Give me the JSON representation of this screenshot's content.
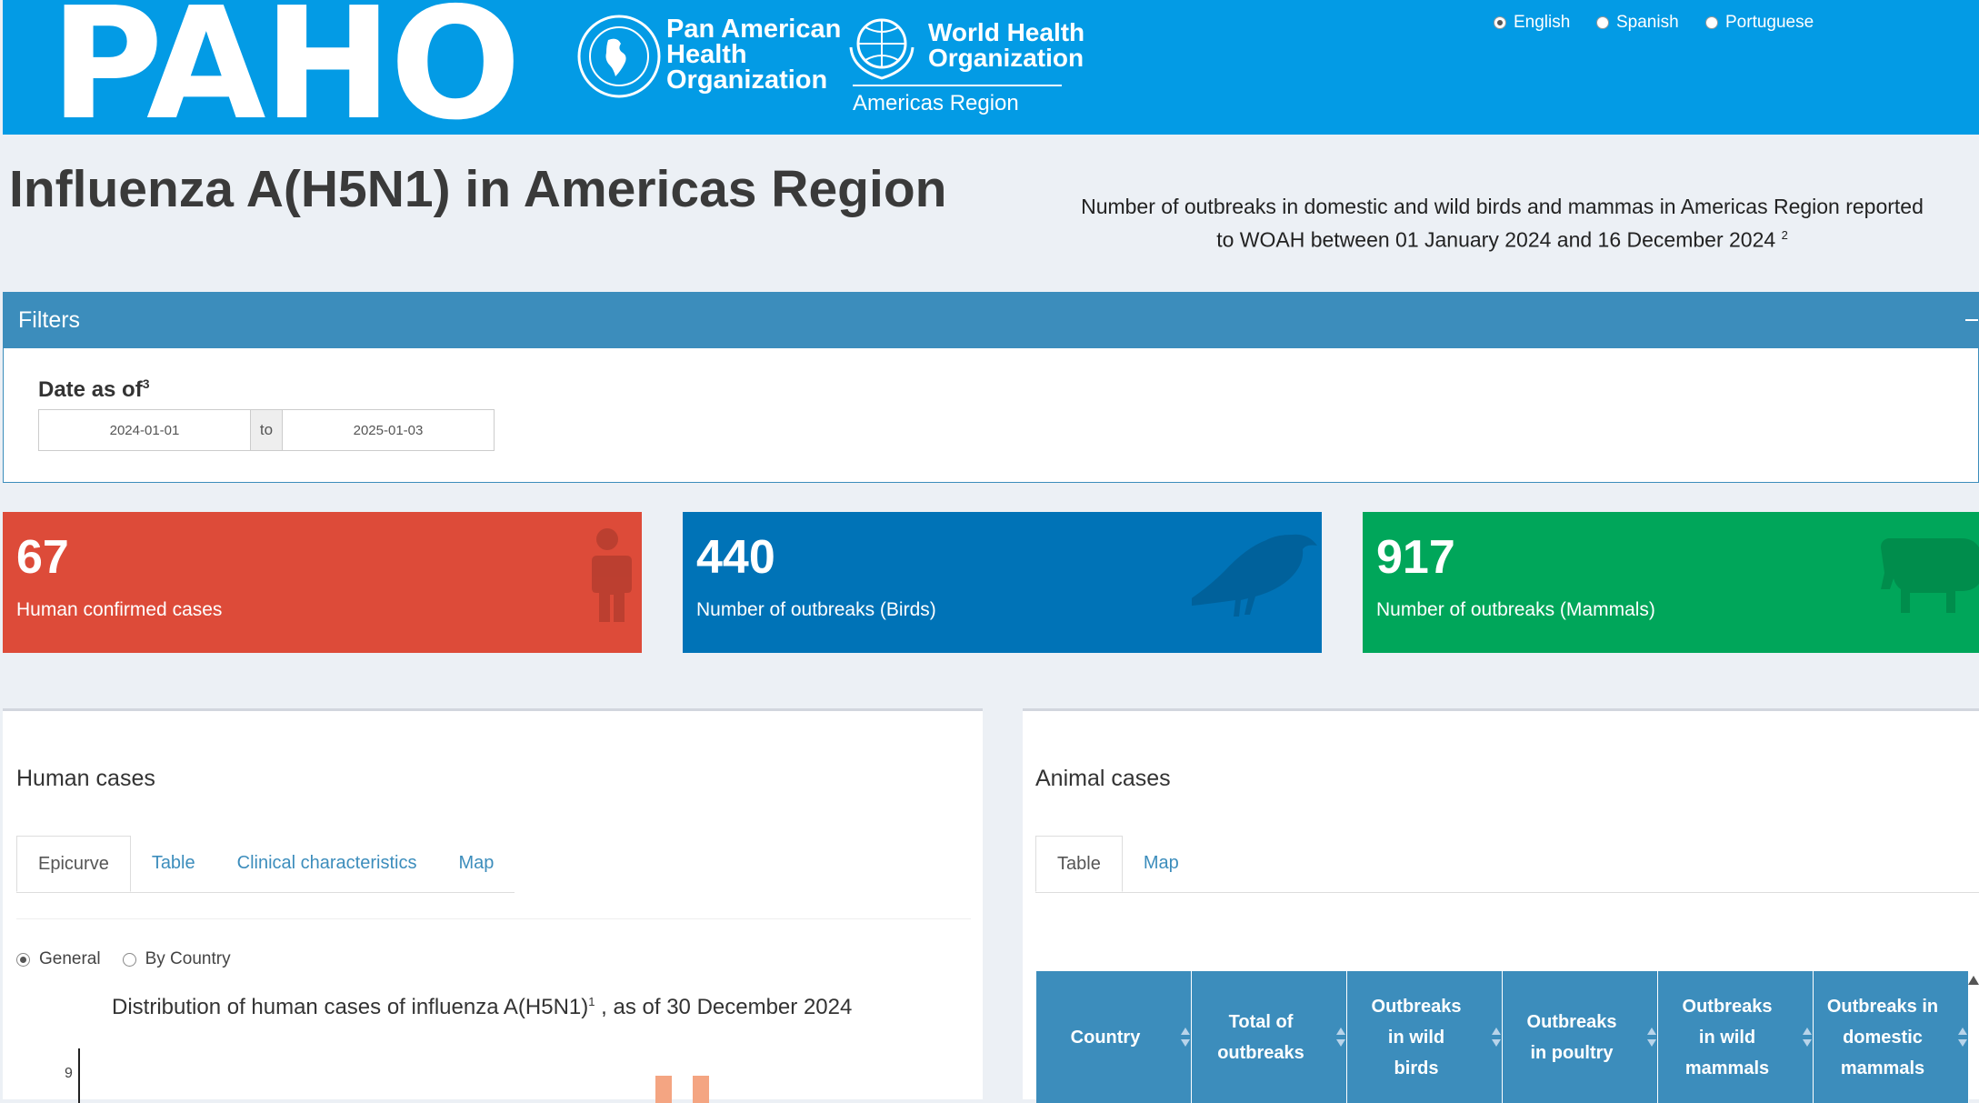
{
  "header": {
    "logo_text": "PAHO",
    "org1_line1": "Pan American",
    "org1_line2": "Health",
    "org1_line3": "Organization",
    "org2_line1": "World Health",
    "org2_line2": "Organization",
    "region": "Americas Region",
    "languages": [
      {
        "label": "English",
        "selected": true
      },
      {
        "label": "Spanish",
        "selected": false
      },
      {
        "label": "Portuguese",
        "selected": false
      }
    ]
  },
  "page": {
    "title": "Influenza A(H5N1) in Americas Region"
  },
  "filters": {
    "title": "Filters",
    "date_label": "Date as of",
    "date_sup": "3",
    "date_start": "2024-01-01",
    "date_sep": "to",
    "date_end": "2025-01-03"
  },
  "kpis": [
    {
      "value": "67",
      "label": "Human confirmed cases",
      "color": "#dd4b39",
      "icon": "person-icon"
    },
    {
      "value": "440",
      "label": "Number of outbreaks (Birds)",
      "color": "#0073b7",
      "icon": "bird-icon"
    },
    {
      "value": "917",
      "label": "Number of outbreaks (Mammals)",
      "color": "#00a65a",
      "icon": "cow-icon"
    }
  ],
  "human": {
    "title": "Human cases",
    "tabs": [
      "Epicurve",
      "Table",
      "Clinical characteristics",
      "Map"
    ],
    "radio_general": "General",
    "radio_by_country": "By Country",
    "chart_title": "Distribution of human cases of influenza A(H5N1)",
    "chart_title_sup": "1",
    "chart_title_suffix": " , as of 30 December 2024",
    "y_tick": "9"
  },
  "animal": {
    "title": "Animal cases",
    "tabs": [
      "Table",
      "Map"
    ],
    "caption_line1": "Number of outbreaks in domestic and wild birds and mammas in Americas Region reported",
    "caption_line2": "to WOAH between 01 January 2024 and 16 December 2024",
    "caption_sup": "2",
    "columns": [
      "Country",
      "Total of outbreaks",
      "Outbreaks in wild birds",
      "Outbreaks in poultry",
      "Outbreaks in wild mammals",
      "Outbreaks in domestic mammals"
    ]
  }
}
